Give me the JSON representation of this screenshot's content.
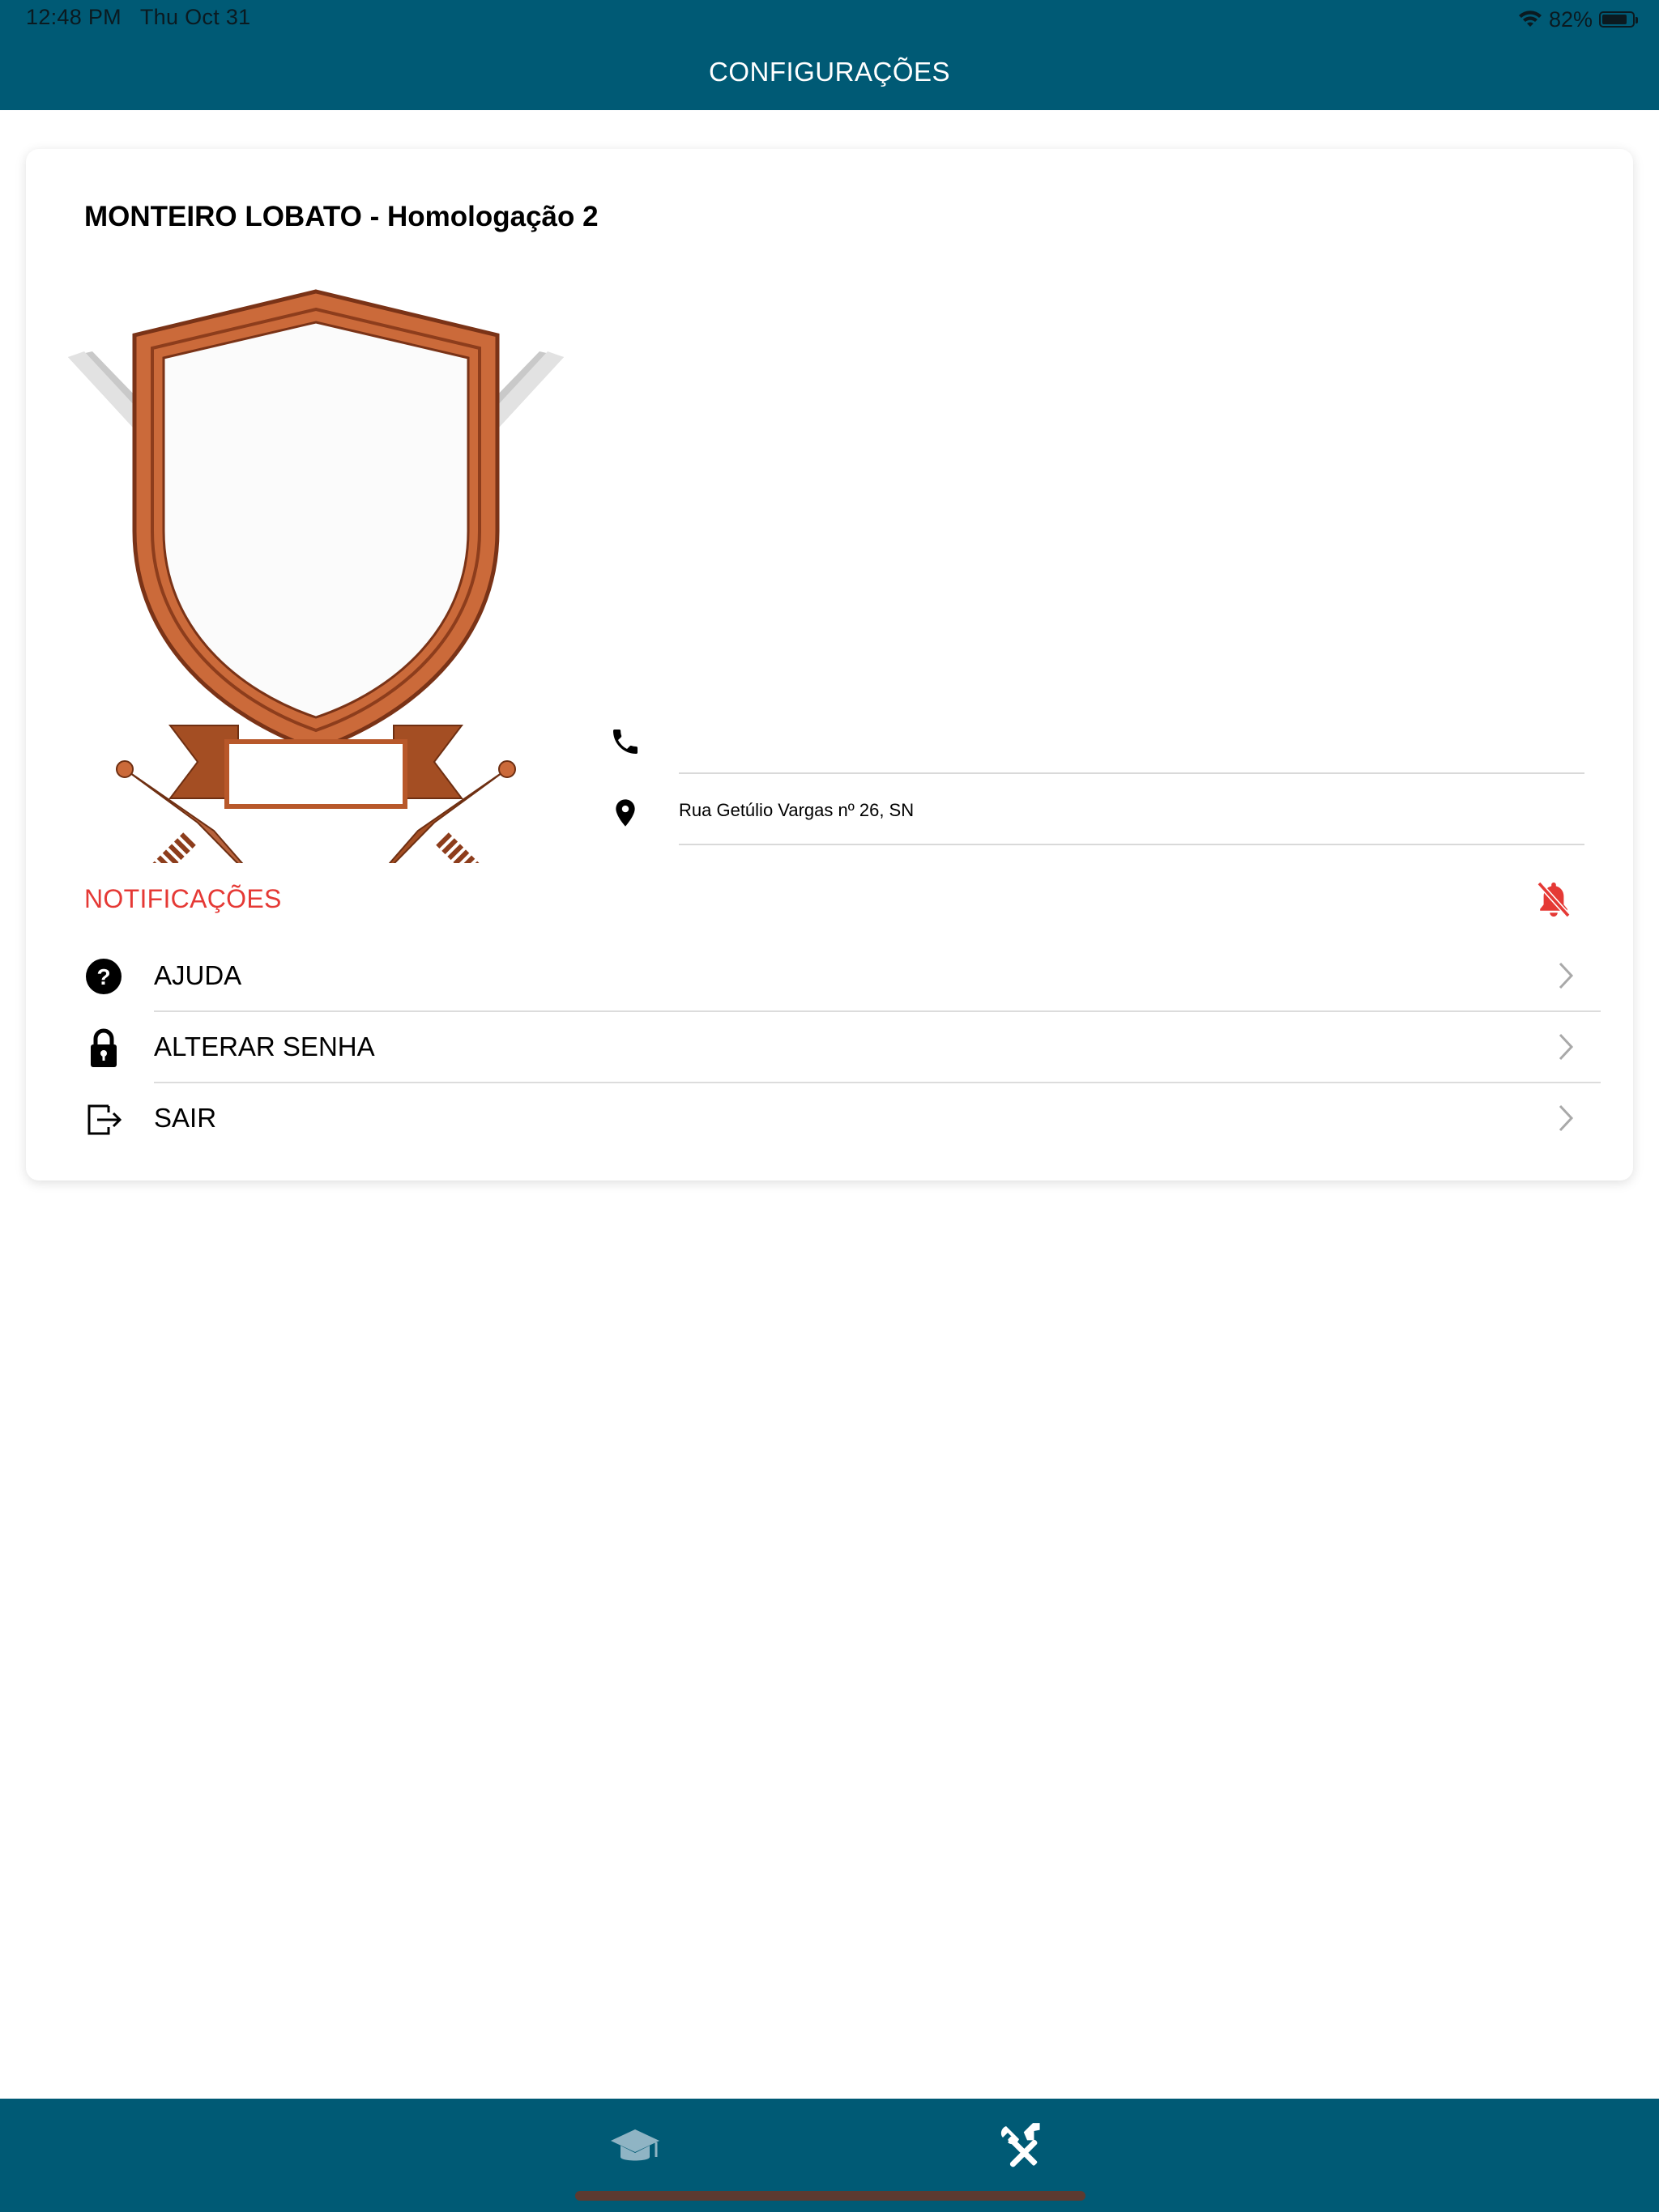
{
  "status_bar": {
    "time": "12:48 PM",
    "date": "Thu Oct 31",
    "battery": "82%",
    "battery_level": 0.82
  },
  "header": {
    "title": "CONFIGURAÇÕES",
    "color": "#005a75"
  },
  "school": {
    "name": "MONTEIRO LOBATO - Homologação 2",
    "phone": "",
    "address": "Rua Getúlio Vargas nº 26, SN"
  },
  "notifications": {
    "label": "NOTIFICAÇÕES",
    "color": "#e53935",
    "icon": "bell-off-icon"
  },
  "menu": [
    {
      "label": "AJUDA",
      "icon": "help-circle-icon"
    },
    {
      "label": "ALTERAR SENHA",
      "icon": "lock-icon"
    },
    {
      "label": "SAIR",
      "icon": "logout-icon"
    }
  ],
  "tabbar": {
    "tabs": [
      {
        "icon": "graduation-cap-icon",
        "active": false
      },
      {
        "icon": "tools-icon",
        "active": true
      }
    ]
  }
}
